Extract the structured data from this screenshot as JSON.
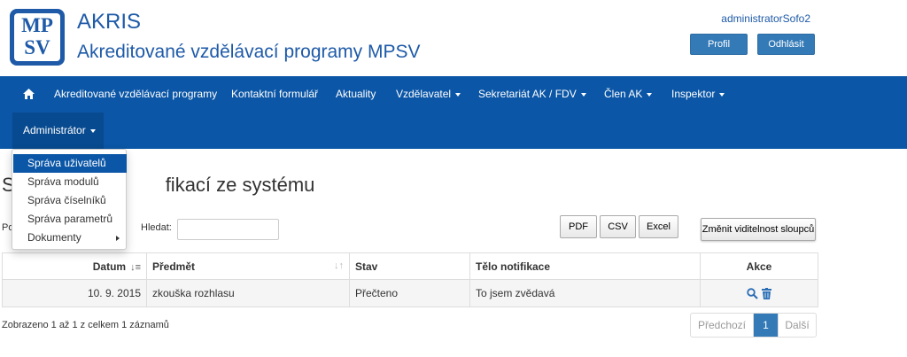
{
  "header": {
    "logo_text_top": "MP",
    "logo_text_bottom": "SV",
    "title": "AKRIS",
    "subtitle": "Akreditované vzdělávací programy MPSV",
    "username": "administratorSofo2",
    "profile_label": "Profil",
    "logout_label": "Odhlásit"
  },
  "nav": {
    "items": [
      {
        "label": "Akreditované vzdělávací programy"
      },
      {
        "label": "Kontaktní formulář"
      },
      {
        "label": "Aktuality"
      },
      {
        "label": "Vzdělavatel"
      },
      {
        "label": "Sekretariát AK / FDV"
      },
      {
        "label": "Člen AK"
      },
      {
        "label": "Inspektor"
      },
      {
        "label": "Administrátor"
      }
    ]
  },
  "dropdown": {
    "items": [
      {
        "label": "Správa uživatelů"
      },
      {
        "label": "Správa modulů"
      },
      {
        "label": "Správa číselníků"
      },
      {
        "label": "Správa parametrů"
      },
      {
        "label": "Dokumenty"
      }
    ]
  },
  "page": {
    "title_visible": "S",
    "title_rest": "fikací ze systému",
    "po_label": "Po",
    "search_label": "Hledat:",
    "search_value": ""
  },
  "toolbar": {
    "pdf": "PDF",
    "csv": "CSV",
    "excel": "Excel",
    "visibility": "Změnit viditelnost sloupců"
  },
  "table": {
    "headers": [
      "Datum",
      "Předmět",
      "Stav",
      "Tělo notifikace",
      "Akce"
    ],
    "rows": [
      [
        "10. 9. 2015",
        "zkouška rozhlasu",
        "Přečteno",
        "To jsem zvědavá"
      ]
    ]
  },
  "footer": {
    "info": "Zobrazeno 1 až 1 z celkem 1 záznamů",
    "prev": "Předchozí",
    "page": "1",
    "next": "Další"
  },
  "colors": {
    "brand": "#1e5aa8",
    "nav": "#0b56a6",
    "primary_button": "#337ab7"
  }
}
